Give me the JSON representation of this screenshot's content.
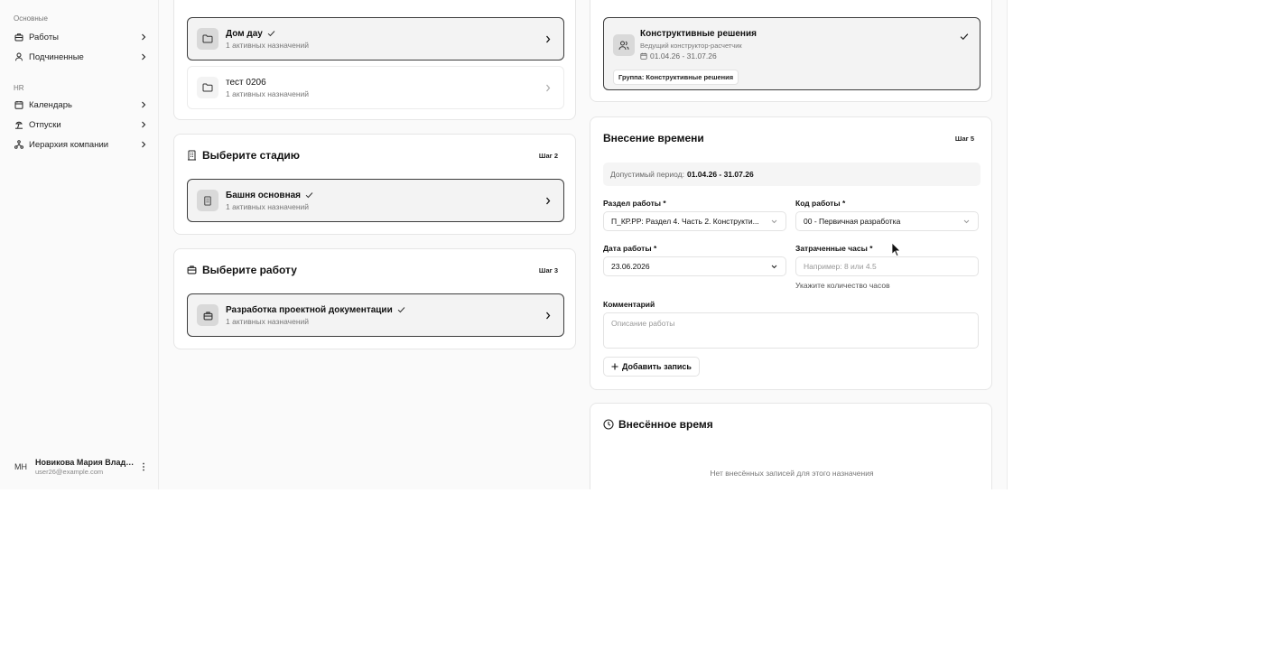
{
  "sidebar": {
    "group_main": "Основные",
    "items_main": [
      {
        "label": "Работы",
        "icon": "briefcase-icon"
      },
      {
        "label": "Подчиненные",
        "icon": "user-icon"
      }
    ],
    "group_hr": "HR",
    "items_hr": [
      {
        "label": "Календарь",
        "icon": "calendar-icon"
      },
      {
        "label": "Отпуски",
        "icon": "beach-icon"
      },
      {
        "label": "Иерархия компании",
        "icon": "hierarchy-icon"
      }
    ],
    "user": {
      "initials": "МН",
      "name": "Новикова Мария Влади...",
      "email": "user26@example.com"
    }
  },
  "projects": [
    {
      "title": "Дом дау",
      "sub": "1 активных назначений",
      "selected": true
    },
    {
      "title": "тест 0206",
      "sub": "1 активных назначений",
      "selected": false
    }
  ],
  "stage": {
    "title": "Выберите стадию",
    "step": "Шаг 2",
    "items": [
      {
        "title": "Башня основная",
        "sub": "1 активных назначений"
      }
    ]
  },
  "work": {
    "title": "Выберите работу",
    "step": "Шаг 3",
    "items": [
      {
        "title": "Разработка проектной документации",
        "sub": "1 активных назначений"
      }
    ]
  },
  "assignment": {
    "title": "Конструктивные решения",
    "role": "Ведущий конструктор-расчетчик",
    "dates": "01.04.26 - 31.07.26",
    "group": "Группа: Конструктивные решения"
  },
  "time_entry": {
    "title": "Внесение времени",
    "step": "Шаг 5",
    "period_label": "Допустимый период:",
    "period_value": "01.04.26 - 31.07.26",
    "section_label": "Раздел работы *",
    "section_value": "П_КР.РР: Раздел 4. Часть 2. Конструкти...",
    "code_label": "Код работы *",
    "code_value": "00 - Первичная разработка",
    "date_label": "Дата работы *",
    "date_value": "23.06.2026",
    "hours_label": "Затраченные часы *",
    "hours_placeholder": "Например: 8 или 4.5",
    "hours_hint": "Укажите количество часов",
    "comment_label": "Комментарий",
    "comment_placeholder": "Описание работы",
    "add_button": "Добавить запись"
  },
  "entered_time": {
    "title": "Внесённое время",
    "empty": "Нет внесённых записей для этого назначения"
  }
}
